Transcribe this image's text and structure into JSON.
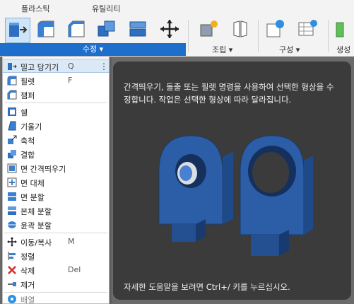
{
  "tabs": [
    {
      "label": "플라스틱"
    },
    {
      "label": "유틸리티"
    }
  ],
  "ribbon": {
    "modify_label": "수정 ▾",
    "assemble_label": "조립 ▾",
    "configure_label": "구성 ▾",
    "create_label": "생성"
  },
  "menu": {
    "items": [
      {
        "label": "밀고 당기기",
        "shortcut": "Q",
        "icon": "press-pull-icon"
      },
      {
        "label": "필렛",
        "shortcut": "F",
        "icon": "fillet-icon"
      },
      {
        "label": "챔퍼",
        "shortcut": "",
        "icon": "chamfer-icon"
      },
      {
        "label": "쉘",
        "shortcut": "",
        "icon": "shell-icon"
      },
      {
        "label": "기울기",
        "shortcut": "",
        "icon": "draft-icon"
      },
      {
        "label": "축척",
        "shortcut": "",
        "icon": "scale-icon"
      },
      {
        "label": "결합",
        "shortcut": "",
        "icon": "combine-icon"
      },
      {
        "label": "면 간격띄우기",
        "shortcut": "",
        "icon": "offset-face-icon"
      },
      {
        "label": "면 대체",
        "shortcut": "",
        "icon": "replace-face-icon"
      },
      {
        "label": "면 분할",
        "shortcut": "",
        "icon": "split-face-icon"
      },
      {
        "label": "본체 분할",
        "shortcut": "",
        "icon": "split-body-icon"
      },
      {
        "label": "윤곽 분할",
        "shortcut": "",
        "icon": "silhouette-split-icon"
      },
      {
        "label": "이동/복사",
        "shortcut": "M",
        "icon": "move-copy-icon"
      },
      {
        "label": "정렬",
        "shortcut": "",
        "icon": "align-icon"
      },
      {
        "label": "삭제",
        "shortcut": "Del",
        "icon": "delete-icon"
      },
      {
        "label": "제거",
        "shortcut": "",
        "icon": "remove-icon"
      },
      {
        "label": "배열",
        "shortcut": "",
        "icon": "pattern-icon"
      }
    ]
  },
  "tooltip": {
    "description": "간격띄우기, 돌출 또는 필렛 명령을 사용하여 선택한 형상을 수정합니다. 작업은 선택한 형상에 따라 달라집니다.",
    "footer": "자세한 도움말을 보려면 Ctrl+/ 키를 누르십시오."
  },
  "colors": {
    "accent": "#1e6fcc",
    "tooltip_bg": "#3b3b3b",
    "part_blue": "#2c5ea8"
  }
}
